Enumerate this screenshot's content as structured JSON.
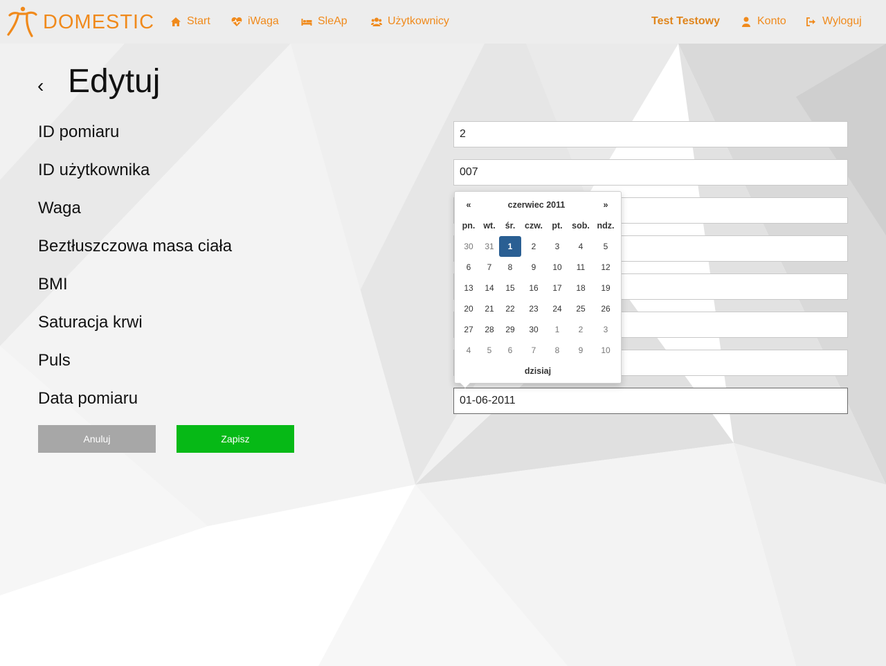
{
  "brand": {
    "name": "DOMESTIC",
    "color": "#f08a1c"
  },
  "nav": {
    "items": [
      {
        "label": "Start",
        "icon": "home-icon"
      },
      {
        "label": "iWaga",
        "icon": "heartbeat-icon"
      },
      {
        "label": "SleAp",
        "icon": "bed-icon"
      },
      {
        "label": "Użytkownicy",
        "icon": "users-icon"
      }
    ],
    "user_name": "Test Testowy",
    "account_label": "Konto",
    "logout_label": "Wyloguj"
  },
  "page": {
    "title": "Edytuj",
    "back_symbol": "‹"
  },
  "form": {
    "fields": [
      {
        "label": "ID pomiaru",
        "value": "2"
      },
      {
        "label": "ID użytkownika",
        "value": "007"
      },
      {
        "label": "Waga",
        "value": ""
      },
      {
        "label": "Beztłuszczowa masa ciała",
        "value": ""
      },
      {
        "label": "BMI",
        "value": ""
      },
      {
        "label": "Saturacja krwi",
        "value": ""
      },
      {
        "label": "Puls",
        "value": ""
      },
      {
        "label": "Data pomiaru",
        "value": "01-06-2011"
      }
    ],
    "cancel_label": "Anuluj",
    "save_label": "Zapisz"
  },
  "datepicker": {
    "prev": "«",
    "next": "»",
    "month_label": "czerwiec 2011",
    "weekdays": [
      "pn.",
      "wt.",
      "śr.",
      "czw.",
      "pt.",
      "sob.",
      "ndz."
    ],
    "weeks": [
      [
        "30",
        "31",
        "1",
        "2",
        "3",
        "4",
        "5"
      ],
      [
        "6",
        "7",
        "8",
        "9",
        "10",
        "11",
        "12"
      ],
      [
        "13",
        "14",
        "15",
        "16",
        "17",
        "18",
        "19"
      ],
      [
        "20",
        "21",
        "22",
        "23",
        "24",
        "25",
        "26"
      ],
      [
        "27",
        "28",
        "29",
        "30",
        "1",
        "2",
        "3"
      ],
      [
        "4",
        "5",
        "6",
        "7",
        "8",
        "9",
        "10"
      ]
    ],
    "selected": "1",
    "today_label": "dzisiaj",
    "active_color": "#2a5f93"
  },
  "colors": {
    "save": "#06b916",
    "cancel": "#a7a7a7",
    "nav_bg": "#ededed"
  }
}
